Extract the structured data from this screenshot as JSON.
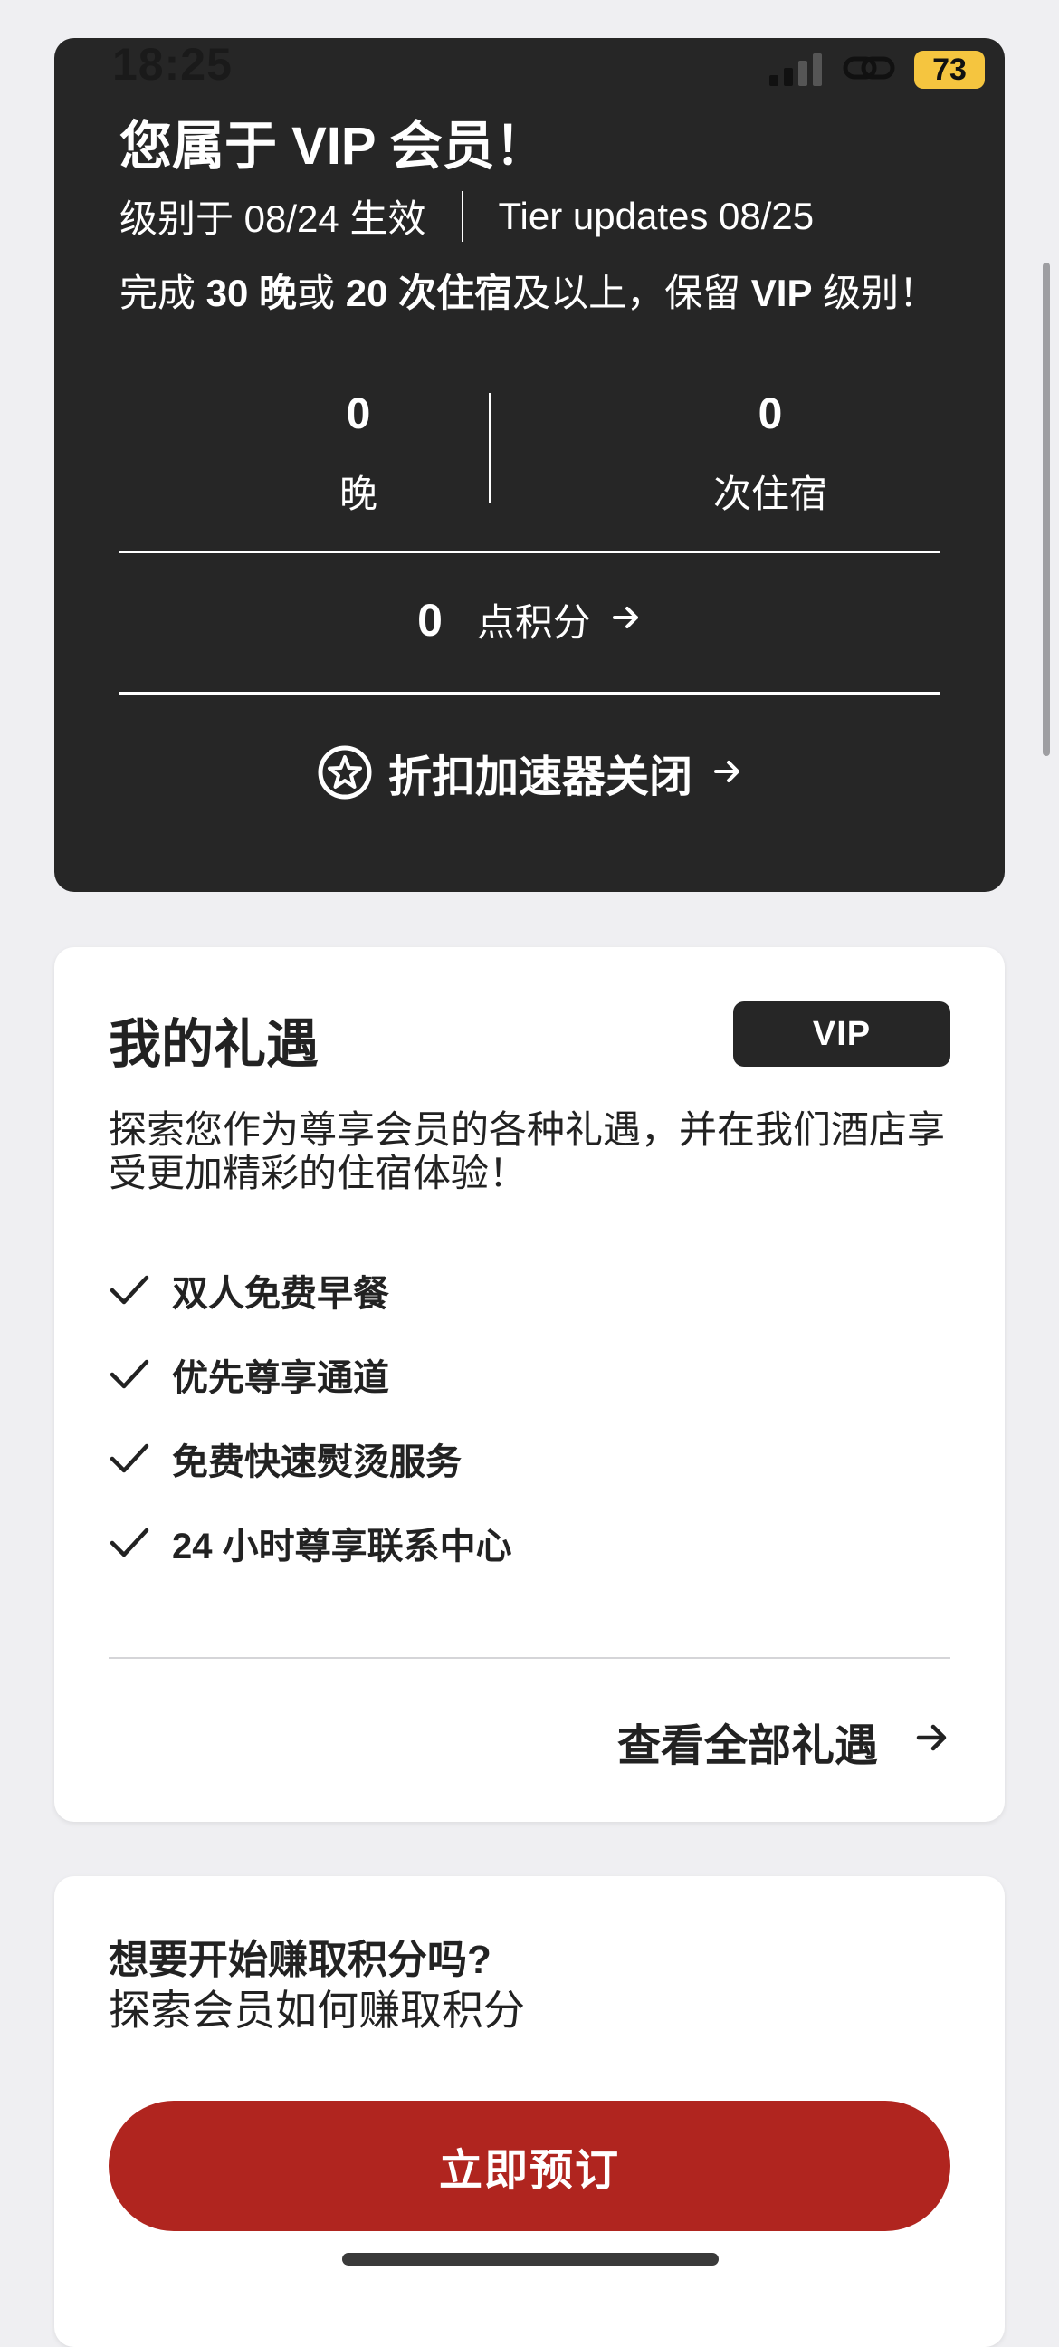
{
  "status_bar": {
    "time": "18:25",
    "battery": "73"
  },
  "status_card": {
    "title": "您属于 VIP 会员！",
    "tier_effective": "级别于 08/24 生效",
    "tier_updates": "Tier updates 08/25",
    "retain": {
      "prefix": "完成 ",
      "nights_goal": "30 晚",
      "or": "或 ",
      "stays_goal": "20 次住宿",
      "suffix": "及以上，保留 ",
      "tier": "VIP",
      "end": " 级别！"
    },
    "nights": {
      "value": "0",
      "label": "晚"
    },
    "stays": {
      "value": "0",
      "label": "次住宿"
    },
    "points": {
      "value": "0",
      "label": "点积分"
    },
    "accelerator_label": "折扣加速器关闭"
  },
  "benefits_card": {
    "title": "我的礼遇",
    "badge": "VIP",
    "description": "探索您作为尊享会员的各种礼遇，并在我们酒店享受更加精彩的住宿体验！",
    "items": [
      {
        "label": "双人免费早餐"
      },
      {
        "label": "优先尊享通道"
      },
      {
        "label": "免费快速熨烫服务"
      },
      {
        "label": "24 小时尊享联系中心"
      }
    ],
    "view_all": "查看全部礼遇"
  },
  "earn_card": {
    "heading": "想要开始赚取积分吗?",
    "subheading": "探索会员如何赚取积分",
    "button": "立即预订"
  },
  "colors": {
    "card_dark": "#262626",
    "background": "#efeff2",
    "accent_red": "#b0251f",
    "battery": "#f5c53f"
  }
}
